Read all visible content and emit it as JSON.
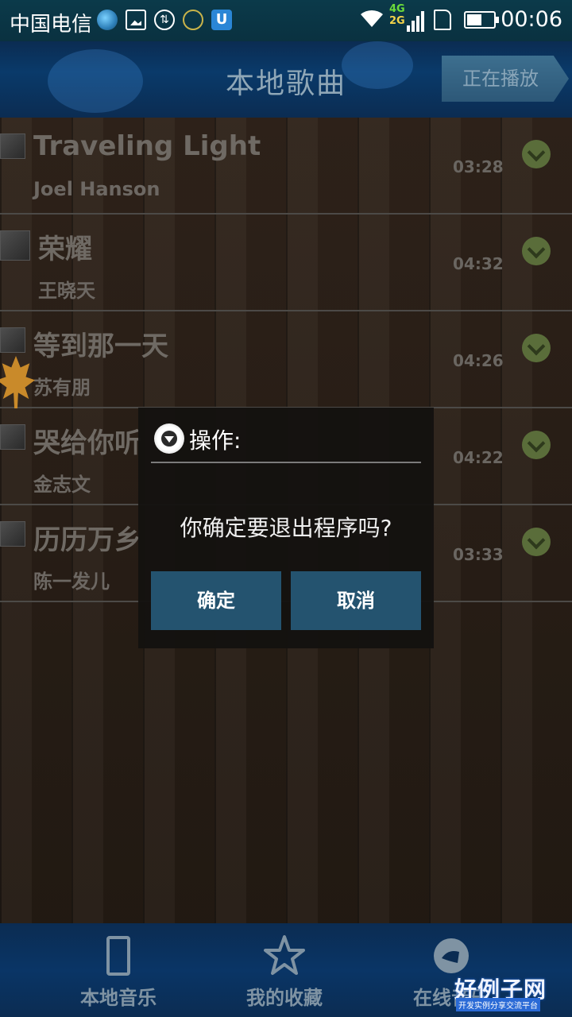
{
  "status_bar": {
    "carrier": "中国电信",
    "net_top": "4G",
    "net_bottom": "2G",
    "time": "00:06",
    "icons": [
      "globe-icon",
      "image-icon",
      "sync-icon",
      "face-icon",
      "u-app-icon",
      "wifi-icon",
      "signal-icon",
      "sim-icon",
      "battery-icon"
    ]
  },
  "header": {
    "title": "本地歌曲",
    "now_playing": "正在播放"
  },
  "songs": [
    {
      "title": "Traveling Light",
      "artist": "Joel Hanson",
      "duration": "03:28"
    },
    {
      "title": "荣耀",
      "artist": "王晓天",
      "duration": "04:32"
    },
    {
      "title": "等到那一天",
      "artist": "苏有朋",
      "duration": "04:26"
    },
    {
      "title": "哭给你听",
      "artist": "金志文",
      "duration": "04:22"
    },
    {
      "title": "历历万乡",
      "artist": "陈一发儿",
      "duration": "03:33"
    }
  ],
  "dialog": {
    "title": "操作:",
    "message": "你确定要退出程序吗?",
    "confirm": "确定",
    "cancel": "取消"
  },
  "bottom_nav": {
    "items": [
      {
        "label": "本地音乐",
        "icon": "phone-icon"
      },
      {
        "label": "我的收藏",
        "icon": "star-icon"
      },
      {
        "label": "在线音乐",
        "icon": "globe-music-icon"
      }
    ]
  },
  "watermark": {
    "main": "好例子网",
    "sub": "开发实例分享交流平台"
  },
  "colors": {
    "header_bg": "#0b2c52",
    "dialog_button": "#24536f",
    "chevron": "#5a6d3a"
  }
}
